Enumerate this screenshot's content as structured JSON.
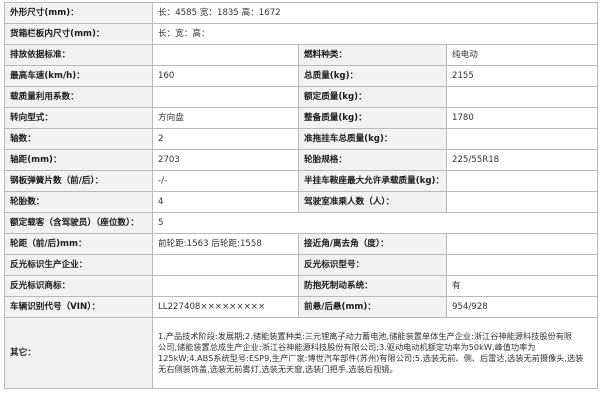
{
  "rows": [
    {
      "type": "full",
      "label": "外形尺寸(mm)：",
      "value": "长：4585 宽：1835 高：1672"
    },
    {
      "type": "full",
      "label": "货箱栏板内尺寸(mm)：",
      "value": "长：宽：高："
    },
    {
      "type": "pair",
      "label1": "排放依据标准：",
      "value1": "",
      "label2": "燃料种类：",
      "value2": "纯电动"
    },
    {
      "type": "pair",
      "label1": "最高车速(km/h)：",
      "value1": "160",
      "label2": "总质量(kg)：",
      "value2": "2155"
    },
    {
      "type": "pair",
      "label1": "载质量利用系数：",
      "value1": "",
      "label2": "额定质量(kg)：",
      "value2": ""
    },
    {
      "type": "pair",
      "label1": "转向型式：",
      "value1": "方向盘",
      "label2": "整备质量(kg)：",
      "value2": "1780"
    },
    {
      "type": "pair",
      "label1": "轴数：",
      "value1": "2",
      "label2": "准拖挂车总质量(kg)：",
      "value2": ""
    },
    {
      "type": "pair",
      "label1": "轴距(mm)：",
      "value1": "2703",
      "label2": "轮胎规格：",
      "value2": "225/55R18"
    },
    {
      "type": "pair",
      "label1": "钢板弹簧片数（前/后）：",
      "value1": "-/-",
      "label2": "半挂车鞍座最大允许承载质量(kg)：",
      "value2": ""
    },
    {
      "type": "pair",
      "label1": "轮胎数：",
      "value1": "4",
      "label2": "驾驶室准乘人数（人）：",
      "value2": ""
    },
    {
      "type": "full",
      "label": "额定载客（含驾驶员）（座位数）：",
      "value": "5"
    },
    {
      "type": "pair",
      "label1": "轮距（前/后)mm：",
      "value1": "前轮距:1563 后轮距:1558",
      "label2": "接近角/离去角（度）：",
      "value2": ""
    },
    {
      "type": "pair",
      "label1": "反光标识生产企业：",
      "value1": "",
      "label2": "反光标识型号：",
      "value2": ""
    },
    {
      "type": "pair",
      "label1": "反光标识商标：",
      "value1": "",
      "label2": "防抱死制动系统：",
      "value2": "有"
    },
    {
      "type": "pair",
      "label1": "车辆识别代号（VIN）：",
      "value1": "LL227408×××××××××",
      "label2": "前悬/后悬(mm)：",
      "value2": "954/928"
    }
  ],
  "other": {
    "label": "其它：",
    "lines": [
      "1.产品技术阶段:发展期;2.储能装置种类:三元锂离子动力蓄电池,储能装置单体生产企业:浙江谷神能源科技股份有限",
      "公司,储能装置总成生产企业:浙江谷神能源科技股份有限公司;3.驱动电动机额定功率为50kW,峰值功率为",
      "125kW;4.ABS系统型号:ESP9,生产厂家:博世汽车部件(苏州)有限公司;5.选装无前、侧、后雷达,选装无前摄像头,选装",
      "无右侧装饰盖,选装无前雾灯,选装无天窗,选装门把手,选装后视镜。"
    ]
  }
}
